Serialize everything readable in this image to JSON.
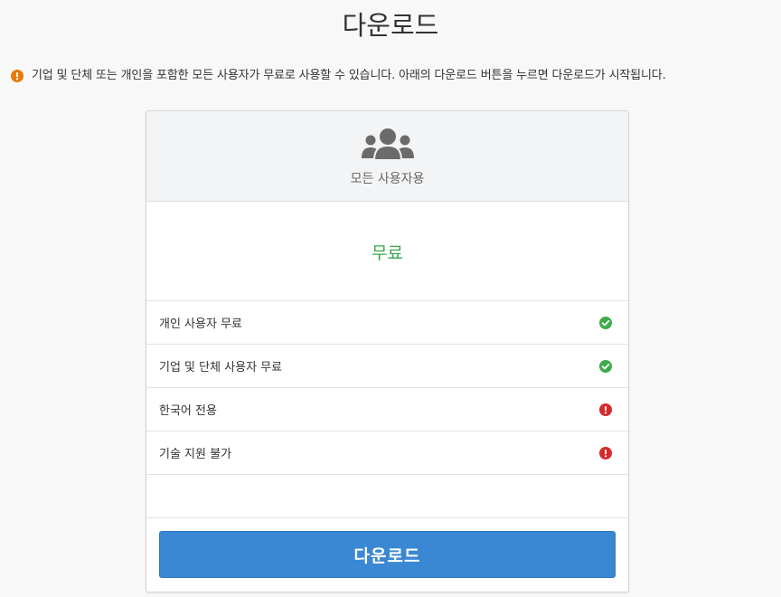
{
  "page": {
    "title": "다운로드"
  },
  "notice": {
    "icon": "exclamation-circle-icon",
    "color": "#e8790c",
    "text": "기업 및 단체 또는 개인을 포함한 모든 사용자가 무료로 사용할 수 있습니다. 아래의 다운로드 버튼을 누르면 다운로드가 시작됩니다."
  },
  "card": {
    "header": {
      "icon": "users-group-icon",
      "plan_name": "모든 사용자용"
    },
    "price": "무료",
    "price_color": "#3aa64a",
    "features": [
      {
        "label": "개인 사용자 무료",
        "status": "check",
        "icon": "check-circle-icon",
        "color": "#3bab4b"
      },
      {
        "label": "기업 및 단체 사용자 무료",
        "status": "check",
        "icon": "check-circle-icon",
        "color": "#3bab4b"
      },
      {
        "label": "한국어 전용",
        "status": "warning",
        "icon": "exclamation-circle-icon",
        "color": "#d42b2b"
      },
      {
        "label": "기술 지원 불가",
        "status": "warning",
        "icon": "exclamation-circle-icon",
        "color": "#d42b2b"
      }
    ],
    "download_label": "다운로드",
    "download_color": "#3a87d4"
  }
}
